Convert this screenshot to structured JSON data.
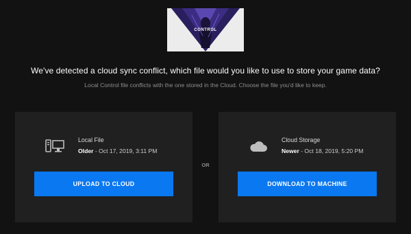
{
  "game": {
    "thumbnail_logo": "CONTROL",
    "thumbnail_icon": "game-cover-art"
  },
  "dialog": {
    "headline": "We've detected a cloud sync conflict, which file would you like to use to store your game data?",
    "subtext": "Local Control file conflicts with the one stored in the Cloud. Choose the file you'd like to keep."
  },
  "local": {
    "icon": "computer-icon",
    "title": "Local File",
    "status": "Older",
    "date": " - Oct 17, 2019, 3:11 PM",
    "button_label": "UPLOAD TO CLOUD"
  },
  "separator": "OR",
  "cloud": {
    "icon": "cloud-icon",
    "title": "Cloud Storage",
    "status": "Newer",
    "date": " - Oct 18, 2019, 5:20 PM",
    "button_label": "DOWNLOAD TO MACHINE"
  },
  "colors": {
    "background": "#121212",
    "panel": "#202020",
    "accent": "#0a78f0"
  }
}
